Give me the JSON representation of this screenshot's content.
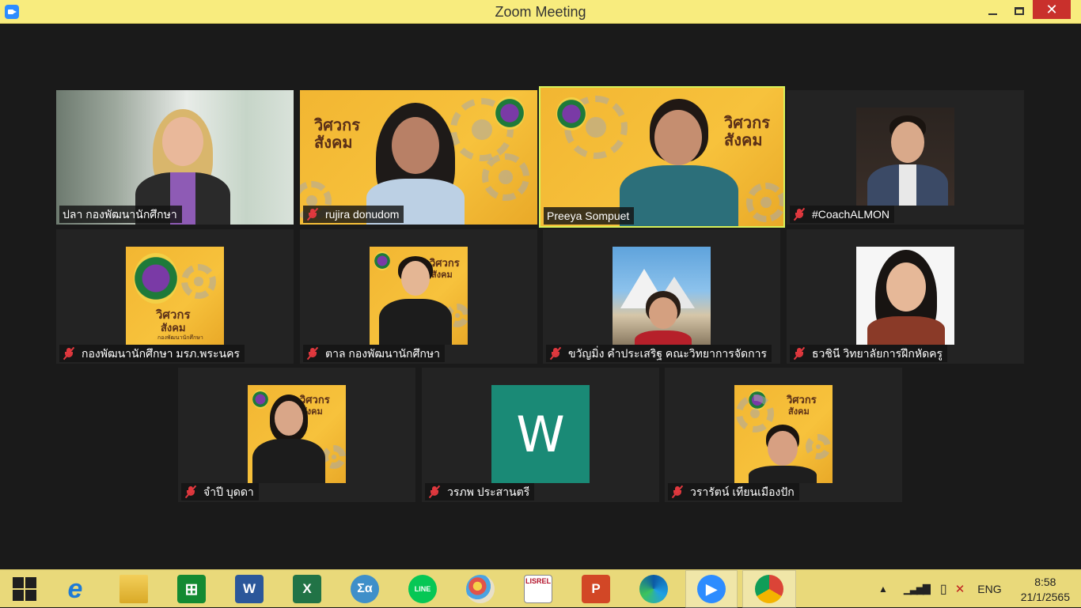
{
  "window": {
    "title": "Zoom Meeting",
    "minimize": "",
    "maximize": "",
    "close": "✕"
  },
  "participants": [
    {
      "name": "ปลา  กองพัฒนานักศึกษา",
      "muted": false,
      "active": false
    },
    {
      "name": "rujira donudom",
      "muted": true,
      "active": false
    },
    {
      "name": "Preeya Sompuet",
      "muted": false,
      "active": true
    },
    {
      "name": "#CoachALMON",
      "muted": true,
      "active": false
    },
    {
      "name": "กองพัฒนานักศึกษา มรภ.พระนคร",
      "muted": true,
      "active": false
    },
    {
      "name": "ตาล กองพัฒนานักศึกษา",
      "muted": true,
      "active": false
    },
    {
      "name": "ขวัญมิ่ง คำประเสริฐ คณะวิทยาการจัดการ",
      "muted": true,
      "active": false
    },
    {
      "name": "ธวชินี  วิทยาลัยการฝึกหัดครู",
      "muted": true,
      "active": false
    },
    {
      "name": "จำปี บุดดา",
      "muted": true,
      "active": false
    },
    {
      "name": "วรภพ ประสานตรี",
      "muted": true,
      "active": false
    },
    {
      "name": "วรารัตน์ เทียนเมืองปัก",
      "muted": true,
      "active": false
    }
  ],
  "posters": {
    "brand_line1": "วิศวกร",
    "brand_line2": "สังคม",
    "subline": "กองพัฒนานักศึกษา",
    "w_avatar": "W"
  },
  "taskbar": {
    "apps": [
      "start",
      "internet-explorer",
      "file-explorer",
      "store",
      "word",
      "excel",
      "math-input",
      "line",
      "paint",
      "lisrel",
      "powerpoint",
      "edge",
      "zoom",
      "chrome"
    ],
    "word_label": "W",
    "excel_label": "X",
    "ppt_label": "P",
    "line_label": "LINE",
    "lisrel_label": "LISREL",
    "language": "ENG",
    "time": "8:58",
    "date": "21/1/2565"
  },
  "colors": {
    "titlebar": "#f8ec7e",
    "active_speaker": "#d6f05a",
    "mute_red": "#e0383e",
    "taskbar": "#e9d97a"
  }
}
